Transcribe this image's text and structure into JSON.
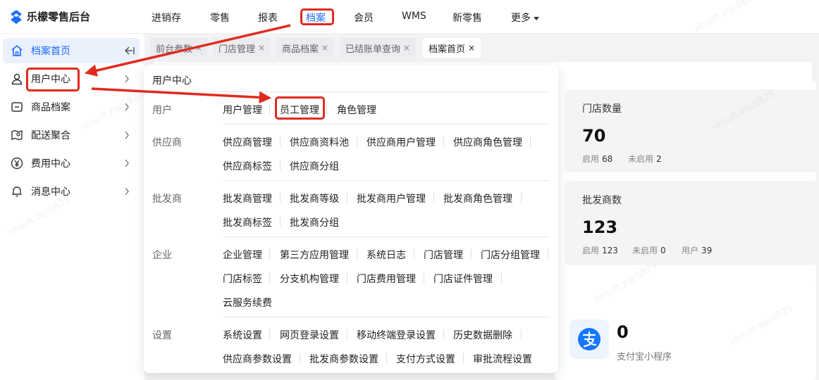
{
  "app": {
    "title": "乐檬零售后台"
  },
  "topnav": [
    {
      "label": "进销存"
    },
    {
      "label": "零售"
    },
    {
      "label": "报表"
    },
    {
      "label": "档案",
      "active": true
    },
    {
      "label": "会员"
    },
    {
      "label": "WMS"
    },
    {
      "label": "新零售"
    },
    {
      "label": "更多"
    }
  ],
  "sidebar": {
    "items": [
      {
        "label": "档案首页",
        "icon": "home-icon",
        "active": true
      },
      {
        "label": "用户中心",
        "icon": "user-icon"
      },
      {
        "label": "商品档案",
        "icon": "product-file-icon"
      },
      {
        "label": "配送聚合",
        "icon": "delivery-map-icon"
      },
      {
        "label": "费用中心",
        "icon": "yen-icon"
      },
      {
        "label": "消息中心",
        "icon": "bell-icon"
      }
    ]
  },
  "tabs": [
    {
      "label": "前台参数"
    },
    {
      "label": "门店管理"
    },
    {
      "label": "商品档案"
    },
    {
      "label": "已结账单查询"
    },
    {
      "label": "档案首页",
      "active": true
    }
  ],
  "tab_close": "×",
  "dropdown": {
    "title": "用户中心",
    "groups": [
      {
        "label": "用户",
        "links": [
          "用户管理",
          "员工管理",
          "角色管理"
        ]
      },
      {
        "label": "供应商",
        "links": [
          "供应商管理",
          "供应商资料池",
          "供应商用户管理",
          "供应商角色管理",
          "供应商标签",
          "供应商分组"
        ]
      },
      {
        "label": "批发商",
        "links": [
          "批发商管理",
          "批发商等级",
          "批发商用户管理",
          "批发商角色管理",
          "批发商标签",
          "批发商分组"
        ]
      },
      {
        "label": "企业",
        "links": [
          "企业管理",
          "第三方应用管理",
          "系统日志",
          "门店管理",
          "门店分组管理",
          "门店标签",
          "分支机构管理",
          "门店费用管理",
          "门店证件管理",
          "云服务续费"
        ]
      },
      {
        "label": "设置",
        "links": [
          "系统设置",
          "网页登录设置",
          "移动终端登录设置",
          "历史数据删除",
          "供应商参数设置",
          "批发商参数设置",
          "支付方式设置",
          "审批流程设置"
        ]
      }
    ]
  },
  "stats": {
    "store": {
      "title": "门店数量",
      "value": "70",
      "enabled_label": "启用",
      "enabled": "68",
      "disabled_label": "未启用",
      "disabled": "2"
    },
    "wholesaler": {
      "title": "批发商数",
      "value": "123",
      "enabled_label": "启用",
      "enabled": "123",
      "disabled_label": "未启用",
      "disabled": "0",
      "user_label": "用户",
      "users": "39"
    }
  },
  "alipay": {
    "value": "0",
    "label": "支付宝小程序",
    "icon": "alipay-icon"
  },
  "watermark": "nhsoft.zqc0829",
  "colors": {
    "accent": "#1e6bff",
    "highlight": "#e02b20"
  }
}
